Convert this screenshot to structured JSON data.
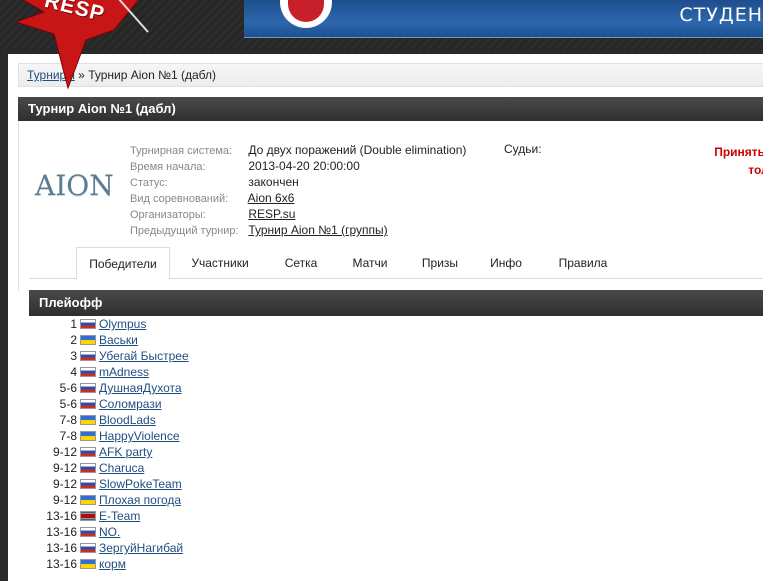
{
  "header": {
    "logo_text": "RESP",
    "banner_text": "СТУДЕН"
  },
  "breadcrumb": {
    "root_link": "Турниры",
    "separator": "»",
    "current": "Турнир Aion №1 (дабл)"
  },
  "panel_title": "Турнир Aion №1 (дабл)",
  "game_logo": "AION",
  "tournament_info": {
    "system_label": "Турнирная система:",
    "system_value": "До двух поражений (Double elimination)",
    "start_label": "Время начала:",
    "start_value": "2013-04-20 20:00:00",
    "status_label": "Статус:",
    "status_value": "закончен",
    "type_label": "Вид соревнований:",
    "type_value": "Aion 6x6",
    "organizers_label": "Организаторы:",
    "organizers_value": "RESP.su",
    "previous_label": "Предыдущий турнир:",
    "previous_value": "Турнир Aion №1 (группы)",
    "judges_label": "Судьи:",
    "join_line1": "Принять уч",
    "join_line2": "тольк"
  },
  "tabs": [
    {
      "label": "Победители",
      "active": true
    },
    {
      "label": "Участники",
      "active": false
    },
    {
      "label": "Сетка",
      "active": false
    },
    {
      "label": "Матчи",
      "active": false
    },
    {
      "label": "Призы",
      "active": false
    },
    {
      "label": "Инфо",
      "active": false
    },
    {
      "label": "Правила",
      "active": false
    }
  ],
  "section_title": "Плейофф",
  "standings": [
    {
      "place": "1",
      "flag": "ru",
      "team": "Olympus"
    },
    {
      "place": "2",
      "flag": "ua",
      "team": "Васьки"
    },
    {
      "place": "3",
      "flag": "ru",
      "team": "Убегай Быстрее"
    },
    {
      "place": "4",
      "flag": "ru",
      "team": "mAdness"
    },
    {
      "place": "5-6",
      "flag": "ru",
      "team": "ДушнаяДухота"
    },
    {
      "place": "5-6",
      "flag": "ru",
      "team": "Соломрази"
    },
    {
      "place": "7-8",
      "flag": "ua",
      "team": "BloodLads"
    },
    {
      "place": "7-8",
      "flag": "ua",
      "team": "HappyViolence"
    },
    {
      "place": "9-12",
      "flag": "ru",
      "team": "AFK party"
    },
    {
      "place": "9-12",
      "flag": "ru",
      "team": "Charuca"
    },
    {
      "place": "9-12",
      "flag": "ru",
      "team": "SlowPokeTeam"
    },
    {
      "place": "9-12",
      "flag": "ua",
      "team": "Плохая погода"
    },
    {
      "place": "13-16",
      "flag": "sz",
      "team": "E-Team"
    },
    {
      "place": "13-16",
      "flag": "ru",
      "team": "NO."
    },
    {
      "place": "13-16",
      "flag": "ru",
      "team": "ЗергуйНагибай"
    },
    {
      "place": "13-16",
      "flag": "ua",
      "team": "корм"
    }
  ]
}
